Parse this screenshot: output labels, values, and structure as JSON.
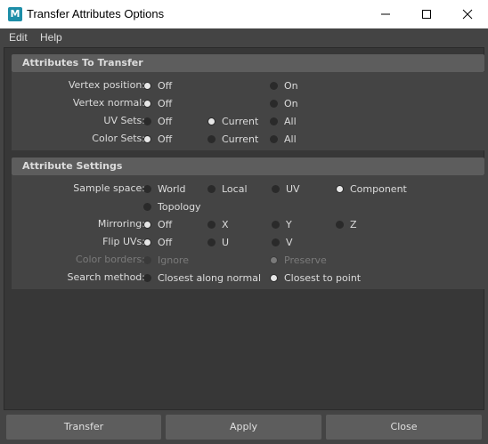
{
  "window": {
    "title": "Transfer Attributes Options",
    "app_icon_letter": "M",
    "controls": [
      "minimize-icon",
      "maximize-icon",
      "close-icon"
    ]
  },
  "menubar": {
    "items": [
      "Edit",
      "Help"
    ]
  },
  "sections": {
    "attributes_to_transfer": {
      "header": "Attributes To Transfer",
      "rows": {
        "vertex_position": {
          "label": "Vertex position:",
          "options": [
            "Off",
            "On"
          ],
          "selected": "Off"
        },
        "vertex_normal": {
          "label": "Vertex normal:",
          "options": [
            "Off",
            "On"
          ],
          "selected": "Off"
        },
        "uv_sets": {
          "label": "UV Sets:",
          "options": [
            "Off",
            "Current",
            "All"
          ],
          "selected": "Current"
        },
        "color_sets": {
          "label": "Color Sets:",
          "options": [
            "Off",
            "Current",
            "All"
          ],
          "selected": "Off"
        }
      }
    },
    "attribute_settings": {
      "header": "Attribute Settings",
      "rows": {
        "sample_space": {
          "label": "Sample space:",
          "options": [
            "World",
            "Local",
            "UV",
            "Component",
            "Topology"
          ],
          "selected": "Component"
        },
        "mirroring": {
          "label": "Mirroring:",
          "options": [
            "Off",
            "X",
            "Y",
            "Z"
          ],
          "selected": "Off"
        },
        "flip_uvs": {
          "label": "Flip UVs:",
          "options": [
            "Off",
            "U",
            "V"
          ],
          "selected": "Off"
        },
        "color_borders": {
          "label": "Color borders:",
          "options": [
            "Ignore",
            "Preserve"
          ],
          "selected": "Preserve",
          "enabled": false
        },
        "search_method": {
          "label": "Search method:",
          "options": [
            "Closest along normal",
            "Closest to point"
          ],
          "selected": "Closest to point"
        }
      }
    }
  },
  "buttons": {
    "transfer": "Transfer",
    "apply": "Apply",
    "close": "Close"
  },
  "colors": {
    "background": "#444444",
    "panel": "#373737",
    "header": "#5d5d5d",
    "text": "#dcdcdc",
    "disabled_text": "#7a7a7a",
    "icon_accent": "#1d8ea8"
  }
}
